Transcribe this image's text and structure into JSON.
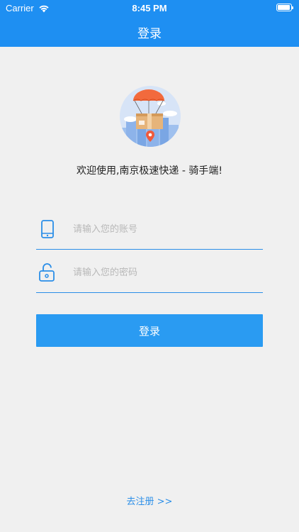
{
  "status_bar": {
    "carrier": "Carrier",
    "time": "8:45 PM"
  },
  "nav": {
    "title": "登录"
  },
  "welcome_text": "欢迎使用,南京极速快递 - 骑手端!",
  "account_field": {
    "placeholder": "请输入您的账号",
    "value": ""
  },
  "password_field": {
    "placeholder": "请输入您的密码",
    "value": ""
  },
  "login_button": {
    "label": "登录"
  },
  "register_link": {
    "label": "去注册 >>"
  },
  "icons": {
    "account": "phone-icon",
    "password": "lock-icon",
    "illustration": "parachute-package-illustration"
  },
  "colors": {
    "nav_background": "#1e8ff2",
    "primary": "#2a9bf2",
    "page_background": "#f0f0f0"
  }
}
